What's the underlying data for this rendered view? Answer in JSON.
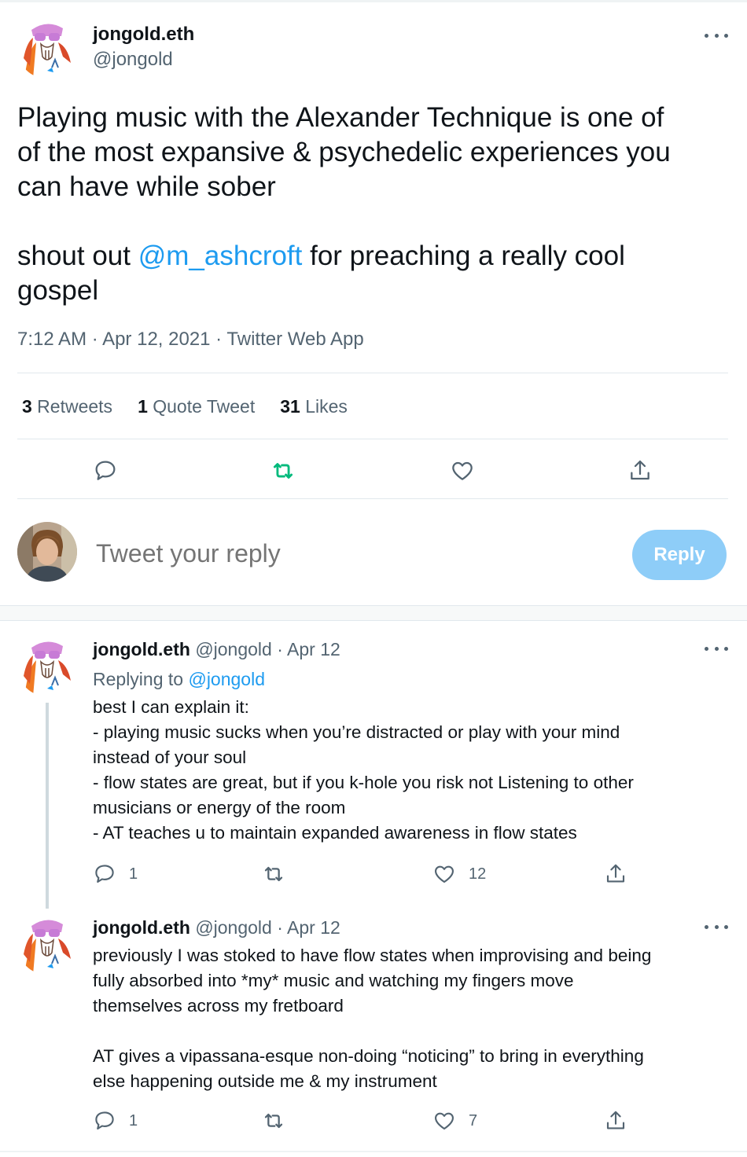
{
  "tweet": {
    "author": {
      "name": "jongold.eth",
      "handle": "@jongold"
    },
    "text_lines": [
      "Playing music with the Alexander Technique is one of",
      "of the most expansive & psychedelic experiences you",
      "can have while sober"
    ],
    "shout_prefix": "shout out ",
    "shout_mention": "@m_ashcroft",
    "shout_suffix": " for preaching a really cool",
    "shout_line2": "gospel",
    "time": "7:12 AM",
    "date": "Apr 12, 2021",
    "source": "Twitter Web App",
    "separator": " · ",
    "stats": {
      "retweets_count": "3",
      "retweets_label": " Retweets",
      "quotes_count": "1",
      "quotes_label": " Quote Tweet",
      "likes_count": "31",
      "likes_label": " Likes"
    }
  },
  "reply_box": {
    "placeholder": "Tweet your reply",
    "button_label": "Reply"
  },
  "replies": [
    {
      "name": "jongold.eth",
      "handle": "@jongold",
      "date": " · Apr 12",
      "replying_prefix": "Replying to ",
      "replying_handle": "@jongold",
      "lines": [
        "best I can explain it:",
        "- playing music sucks when you’re distracted or play with your mind",
        "instead of your soul",
        "- flow states are great, but if you k-hole you risk not Listening to other",
        "musicians or energy of the room",
        "- AT teaches u to maintain expanded awareness in flow states"
      ],
      "reply_count": "1",
      "retweet_count": "",
      "like_count": "12"
    },
    {
      "name": "jongold.eth",
      "handle": "@jongold",
      "date": " · Apr 12",
      "lines": [
        "previously I was stoked to have flow states when improvising and being",
        "fully absorbed into *my* music and watching my fingers move",
        "themselves across my fretboard",
        "",
        "AT gives a vipassana-esque non-doing “noticing” to bring in everything",
        "else happening outside me & my instrument"
      ],
      "reply_count": "1",
      "retweet_count": "",
      "like_count": "7"
    }
  ],
  "colors": {
    "accent": "#1d9bf0",
    "retweet_green": "#00ba7c",
    "muted": "#536471",
    "reply_button_disabled": "#8ecdf8"
  },
  "icons": {
    "reply": "speech-bubble-icon",
    "retweet": "retweet-arrows-icon",
    "like": "heart-icon",
    "share": "share-upload-icon",
    "more": "more-dots-icon"
  }
}
